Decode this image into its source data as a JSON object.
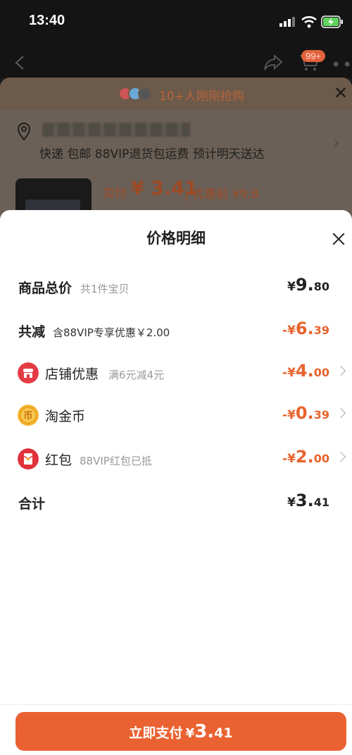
{
  "status_bar": {
    "time": "13:40"
  },
  "nav": {
    "cart_badge": "99+"
  },
  "banner": {
    "text": "10+人刚刚抢购"
  },
  "address": {
    "delivery_line": "快递 包邮 88VIP退货包运费 预计明天送达"
  },
  "order_preview": {
    "paid_label": "实付",
    "paid_price": "¥ 3.41",
    "pre_discount": "| 优惠前 ¥9.8"
  },
  "sheet": {
    "title": "价格明细",
    "rows": [
      {
        "label": "商品总价",
        "sub": "共1件宝贝",
        "sym": "¥",
        "int": "9.",
        "dec": "80",
        "icon": ""
      },
      {
        "label": "共减",
        "sub": "含88VIP专享优惠￥2.00",
        "sym": "-¥",
        "int": "6.",
        "dec": "39",
        "icon": ""
      },
      {
        "label": "店铺优惠",
        "sub": "满6元减4元",
        "sym": "-¥",
        "int": "4.",
        "dec": "00",
        "icon": "shop-icon"
      },
      {
        "label": "淘金币",
        "sub": "",
        "sym": "-¥",
        "int": "0.",
        "dec": "39",
        "icon": "coin-icon"
      },
      {
        "label": "红包",
        "sub": "88VIP红包已抵",
        "sym": "-¥",
        "int": "2.",
        "dec": "00",
        "icon": "red-envelope-icon"
      },
      {
        "label": "合计",
        "sub": "",
        "sym": "¥",
        "int": "3.",
        "dec": "41",
        "icon": ""
      }
    ]
  },
  "pay_button": {
    "label": "立即支付",
    "sym": "¥",
    "int": "3.",
    "dec": "41"
  },
  "colors": {
    "accent": "#ea6232",
    "discount": "#e8632d"
  }
}
